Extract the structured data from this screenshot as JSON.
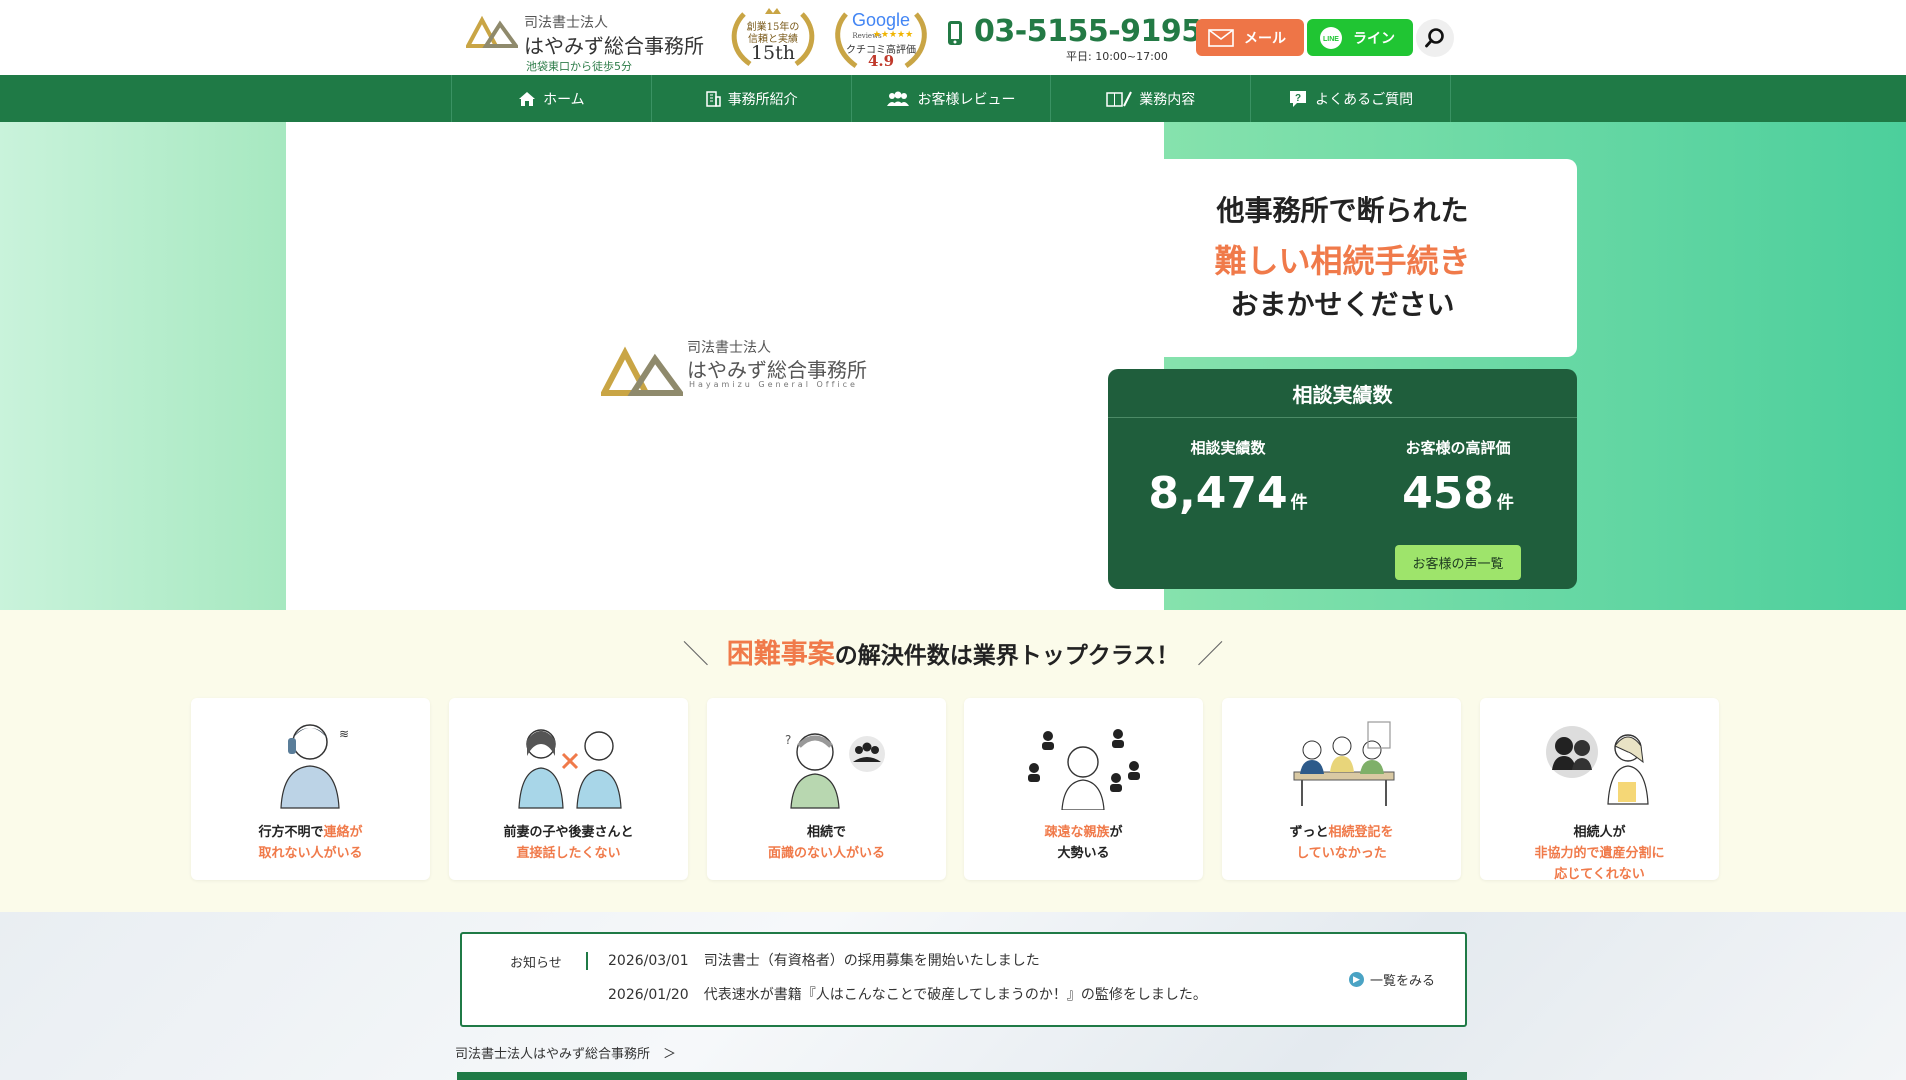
{
  "header": {
    "logo": {
      "line1": "司法書士法人",
      "line2": "はやみず総合事務所",
      "access": "池袋東口から徒歩5分"
    },
    "award_years": {
      "line1": "創業15年の",
      "line2": "信頼と実績",
      "big": "15th"
    },
    "award_google": {
      "brand": "Google",
      "reviews": "Reviews",
      "line": "クチコミ高評価",
      "score": "4.9"
    },
    "phone": {
      "number": "03-5155-9195",
      "hours": "平日: 10:00~17:00"
    },
    "mail_label": "メール",
    "line_label": "ライン",
    "line_icon_text": "LINE"
  },
  "nav": {
    "items": [
      {
        "label": "ホーム",
        "icon": "home-icon"
      },
      {
        "label": "事務所紹介",
        "icon": "building-icon"
      },
      {
        "label": "お客様レビュー",
        "icon": "users-icon"
      },
      {
        "label": "業務内容",
        "icon": "book-pen-icon"
      },
      {
        "label": "よくあるご質問",
        "icon": "question-icon"
      }
    ]
  },
  "hero": {
    "logo": {
      "line1": "司法書士法人",
      "line2": "はやみず総合事務所",
      "line3": "Hayamizu General Office"
    },
    "copy": {
      "line1": "他事務所で断られた",
      "line2": "難しい相続手続き",
      "line3": "おまかせください"
    },
    "stats": {
      "title": "相談実績数",
      "left": {
        "label": "相談実績数",
        "value": "8,474",
        "unit": "件"
      },
      "right": {
        "label": "お客様の高評価",
        "value": "458",
        "unit": "件"
      },
      "voice_button": "お客様の声一覧"
    }
  },
  "cases": {
    "title_highlight": "困難事案",
    "title_rest": "の解決件数は業界トップクラス！",
    "cards": [
      {
        "a": "行方不明で",
        "b": "連絡が",
        "c": "取れない人がいる",
        "d": ""
      },
      {
        "a": "前妻の子や後妻さんと",
        "b": "",
        "c": "直接話したくない",
        "d": ""
      },
      {
        "a": "相続で",
        "b": "",
        "c": "面識のない人がいる",
        "d": ""
      },
      {
        "a": "疎遠な親族",
        "b": "が",
        "c": "大勢いる",
        "d": ""
      },
      {
        "a": "ずっと",
        "b": "相続登記を",
        "c": "していなかった",
        "d": ""
      },
      {
        "a": "相続人が",
        "b": "",
        "c": "非協力的で遺産分割に",
        "d": "応じてくれない"
      }
    ]
  },
  "news": {
    "label": "お知らせ",
    "items": [
      {
        "date": "2026/03/01",
        "text": "司法書士（有資格者）の採用募集を開始いたしました"
      },
      {
        "date": "2026/01/20",
        "text": "代表速水が書籍『人はこんなことで破産してしまうのか！』の監修をしました。"
      }
    ],
    "more": "一覧をみる"
  },
  "breadcrumb": "司法書士法人はやみず総合事務所　＞",
  "colors": {
    "brand_green": "#1f7a46",
    "dark_green": "#1f5e3c",
    "accent_orange": "#f07a4a",
    "line_green": "#20c533",
    "mail_orange": "#ee7547",
    "gold": "#c9a545"
  }
}
